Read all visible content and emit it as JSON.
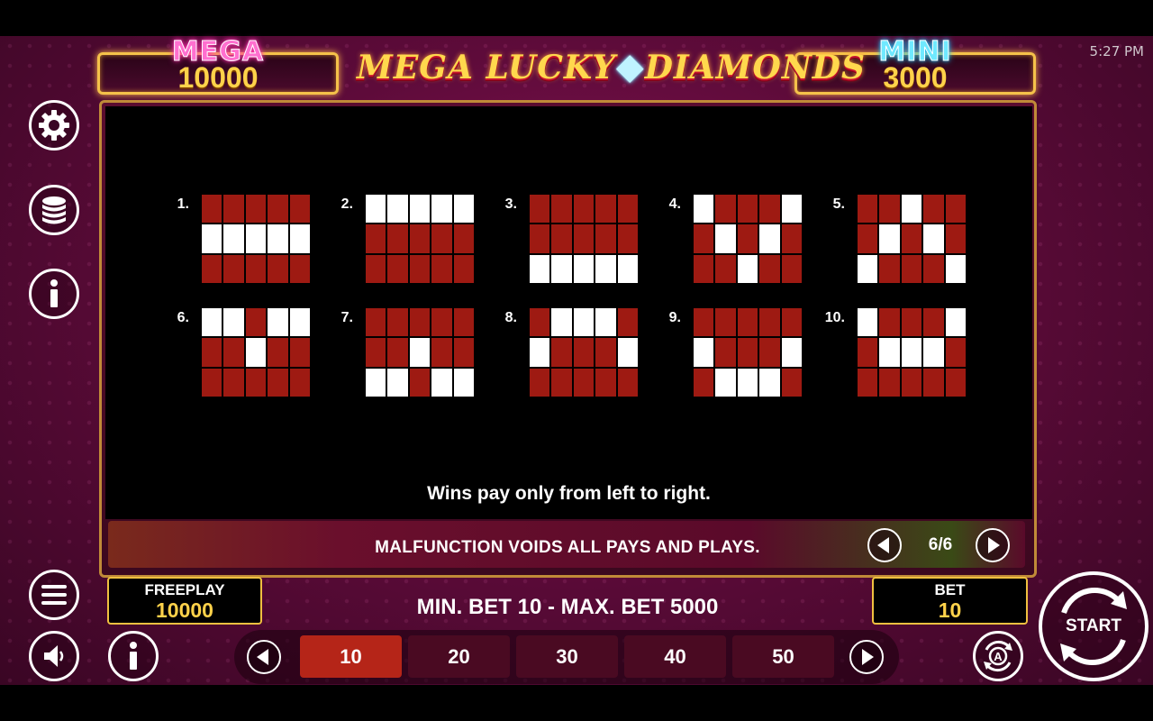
{
  "status": {
    "time": "5:27 PM"
  },
  "header": {
    "logo_text_1": "MEGA LUCKY",
    "logo_gem": "◆",
    "logo_text_2": "DIAMONDS",
    "mega": {
      "label": "MEGA",
      "value": "10000"
    },
    "mini": {
      "label": "MINI",
      "value": "3000"
    }
  },
  "paylines": [
    {
      "label": "1.",
      "pattern": [
        "00000",
        "11111",
        "00000"
      ]
    },
    {
      "label": "2.",
      "pattern": [
        "11111",
        "00000",
        "00000"
      ]
    },
    {
      "label": "3.",
      "pattern": [
        "00000",
        "00000",
        "11111"
      ]
    },
    {
      "label": "4.",
      "pattern": [
        "10001",
        "01010",
        "00100"
      ]
    },
    {
      "label": "5.",
      "pattern": [
        "00100",
        "01010",
        "10001"
      ]
    },
    {
      "label": "6.",
      "pattern": [
        "11011",
        "00100",
        "00000"
      ]
    },
    {
      "label": "7.",
      "pattern": [
        "00000",
        "00100",
        "11011"
      ]
    },
    {
      "label": "8.",
      "pattern": [
        "01110",
        "10001",
        "00000"
      ]
    },
    {
      "label": "9.",
      "pattern": [
        "00000",
        "10001",
        "01110"
      ]
    },
    {
      "label": "10.",
      "pattern": [
        "10001",
        "01110",
        "00000"
      ]
    }
  ],
  "panel": {
    "wins_note": "Wins pay only from left to right.",
    "malfunction": "MALFUNCTION VOIDS ALL PAYS AND PLAYS.",
    "page": "6/6"
  },
  "footer": {
    "freeplay_label": "FREEPLAY",
    "freeplay_value": "10000",
    "bet_range": "MIN. BET 10 - MAX. BET 5000",
    "bet_label": "BET",
    "bet_value": "10",
    "bet_options": [
      "10",
      "20",
      "30",
      "40",
      "50"
    ],
    "selected_bet": "10",
    "start_label": "START"
  },
  "colors": {
    "cell_off": "#9e1a12",
    "cell_on": "#ffffff",
    "gold": "#ffd24a",
    "selected_bet": "#b52518"
  },
  "icons": [
    "settings-gear-icon",
    "coins-stack-icon",
    "info-icon",
    "menu-icon",
    "sound-icon",
    "info-icon",
    "arrow-left-icon",
    "arrow-right-icon",
    "autoplay-icon",
    "start-spin-icon"
  ]
}
